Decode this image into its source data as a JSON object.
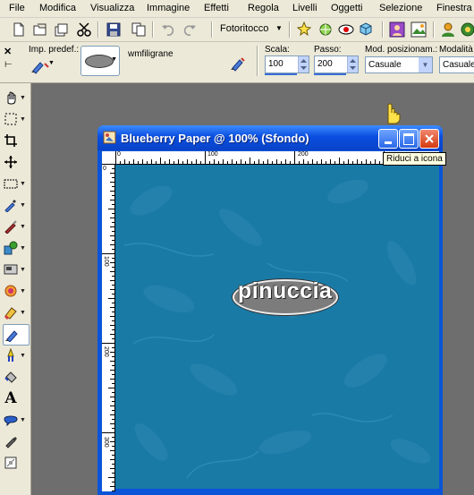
{
  "menu": [
    "File",
    "Modifica",
    "Visualizza",
    "Immagine",
    "Effetti",
    "Regola",
    "Livelli",
    "Oggetti",
    "Selezione",
    "Finestra"
  ],
  "toolbar1": {
    "workspace_combo": "Fotoritocco"
  },
  "toolbar2": {
    "preset_label": "Imp. predef.:",
    "brush_name": "wmfiligrane",
    "scale_label": "Scala:",
    "scale_value": "100",
    "step_label": "Passo:",
    "step_value": "200",
    "position_mode_label": "Mod. posizionam.:",
    "position_mode_value": "Casuale",
    "selection_mode_label": "Modalità s",
    "selection_mode_value": "Casuale"
  },
  "image_window": {
    "title": "Blueberry Paper @ 100% (Sfondo)",
    "ruler_top_labels": [
      "0",
      "100",
      "200"
    ],
    "ruler_left_labels": [
      "0",
      "100",
      "200",
      "300"
    ],
    "watermark_text": "pinuccia"
  },
  "tooltip": "Riduci a icona",
  "icons": {
    "toolbox": [
      "pan-icon",
      "selection-icon",
      "crop-icon",
      "move-icon",
      "selection-rect-icon",
      "dropper-icon",
      "brush-icon",
      "clone-icon",
      "scratch-icon",
      "dodge-icon",
      "eraser-icon",
      "picture-tube-icon",
      "flood-fill-icon",
      "fill-icon",
      "text-icon",
      "shape-icon",
      "pen-icon",
      "deform-icon"
    ]
  }
}
